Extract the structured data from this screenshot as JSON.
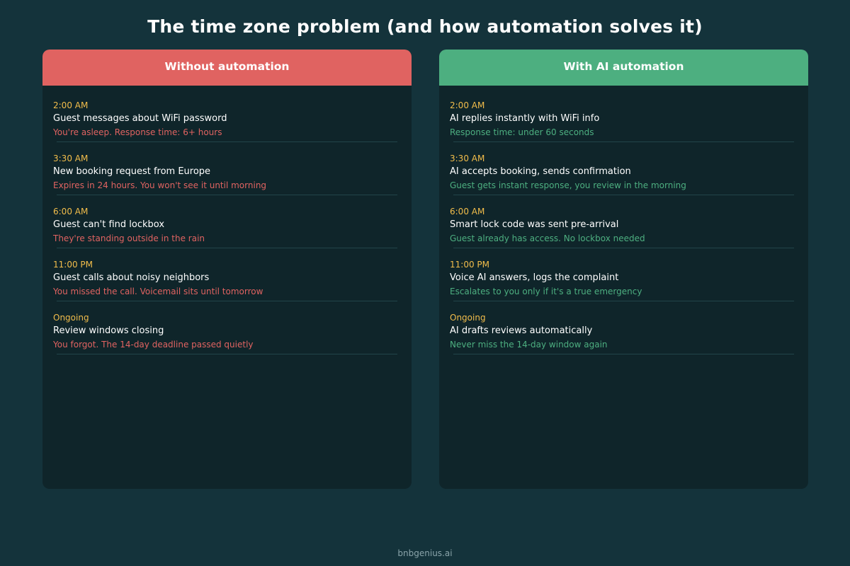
{
  "title": "The time zone problem (and how automation solves it)",
  "footer": "bnbgenius.ai",
  "colors": {
    "background": "#14333b",
    "panel": "#0f252a",
    "without_accent": "#e06361",
    "with_accent": "#4daf80",
    "time": "#f2bd4b"
  },
  "without": {
    "header": "Without automation",
    "rows": [
      {
        "time": "2:00 AM",
        "event": "Guest messages about WiFi password",
        "note": "You're asleep. Response time: 6+ hours"
      },
      {
        "time": "3:30 AM",
        "event": "New booking request from Europe",
        "note": "Expires in 24 hours. You won't see it until morning"
      },
      {
        "time": "6:00 AM",
        "event": "Guest can't find lockbox",
        "note": "They're standing outside in the rain"
      },
      {
        "time": "11:00 PM",
        "event": "Guest calls about noisy neighbors",
        "note": "You missed the call. Voicemail sits until tomorrow"
      },
      {
        "time": "Ongoing",
        "event": "Review windows closing",
        "note": "You forgot. The 14-day deadline passed quietly"
      }
    ]
  },
  "with": {
    "header": "With AI automation",
    "rows": [
      {
        "time": "2:00 AM",
        "event": "AI replies instantly with WiFi info",
        "note": "Response time: under 60 seconds"
      },
      {
        "time": "3:30 AM",
        "event": "AI accepts booking, sends confirmation",
        "note": "Guest gets instant response, you review in the morning"
      },
      {
        "time": "6:00 AM",
        "event": "Smart lock code was sent pre-arrival",
        "note": "Guest already has access. No lockbox needed"
      },
      {
        "time": "11:00 PM",
        "event": "Voice AI answers, logs the complaint",
        "note": "Escalates to you only if it's a true emergency"
      },
      {
        "time": "Ongoing",
        "event": "AI drafts reviews automatically",
        "note": "Never miss the 14-day window again"
      }
    ]
  }
}
